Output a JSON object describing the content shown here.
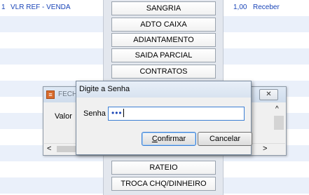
{
  "grid": {
    "first_row": {
      "col1": "1",
      "col2": "VLR REF - VENDA",
      "amount": "1,00",
      "action": "Receber"
    }
  },
  "menu": {
    "buttons": [
      "SANGRIA",
      "ADTO CAIXA",
      "ADIANTAMENTO",
      "SAIDA PARCIAL",
      "CONTRATOS",
      "RATEIO",
      "TROCA CHQ/DINHEIRO"
    ]
  },
  "under_window": {
    "title_partial": "FECH",
    "valor_label": "Valor",
    "close_glyph": "✕",
    "scroll_up": "^",
    "scroll_left": "<",
    "scroll_right": ">"
  },
  "password_dialog": {
    "title": "Digite a Senha",
    "field_label": "Senha",
    "password_mask": "•••",
    "confirm_mnemonic": "C",
    "confirm_rest": "onfirmar",
    "cancel_label": "Cancelar"
  },
  "colors": {
    "row_alt": "#eaf0fa",
    "link_blue": "#1a45b8",
    "focus_blue": "#3c7fd4"
  }
}
